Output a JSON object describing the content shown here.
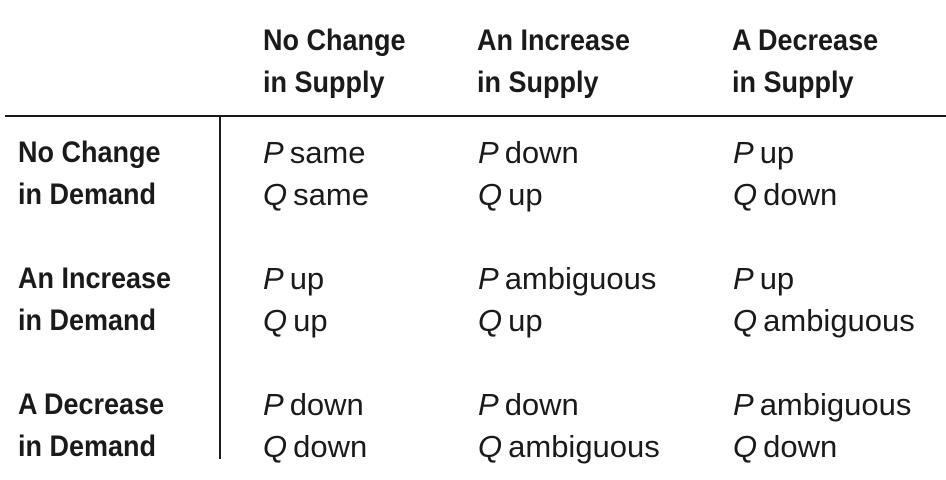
{
  "columns": [
    {
      "line1": "No Change",
      "line2": "in Supply"
    },
    {
      "line1": "An Increase",
      "line2": "in Supply"
    },
    {
      "line1": "A Decrease",
      "line2": "in Supply"
    }
  ],
  "rows": [
    {
      "line1": "No Change",
      "line2": "in Demand",
      "cells": [
        {
          "p": "same",
          "q": "same"
        },
        {
          "p": "down",
          "q": "up"
        },
        {
          "p": "up",
          "q": "down"
        }
      ]
    },
    {
      "line1": "An Increase",
      "line2": "in Demand",
      "cells": [
        {
          "p": "up",
          "q": "up"
        },
        {
          "p": "ambiguous",
          "q": "up"
        },
        {
          "p": "up",
          "q": "ambiguous"
        }
      ]
    },
    {
      "line1": "A Decrease",
      "line2": "in Demand",
      "cells": [
        {
          "p": "down",
          "q": "down"
        },
        {
          "p": "down",
          "q": "ambiguous"
        },
        {
          "p": "ambiguous",
          "q": "down"
        }
      ]
    }
  ],
  "symbols": {
    "price": "P",
    "quantity": "Q"
  }
}
